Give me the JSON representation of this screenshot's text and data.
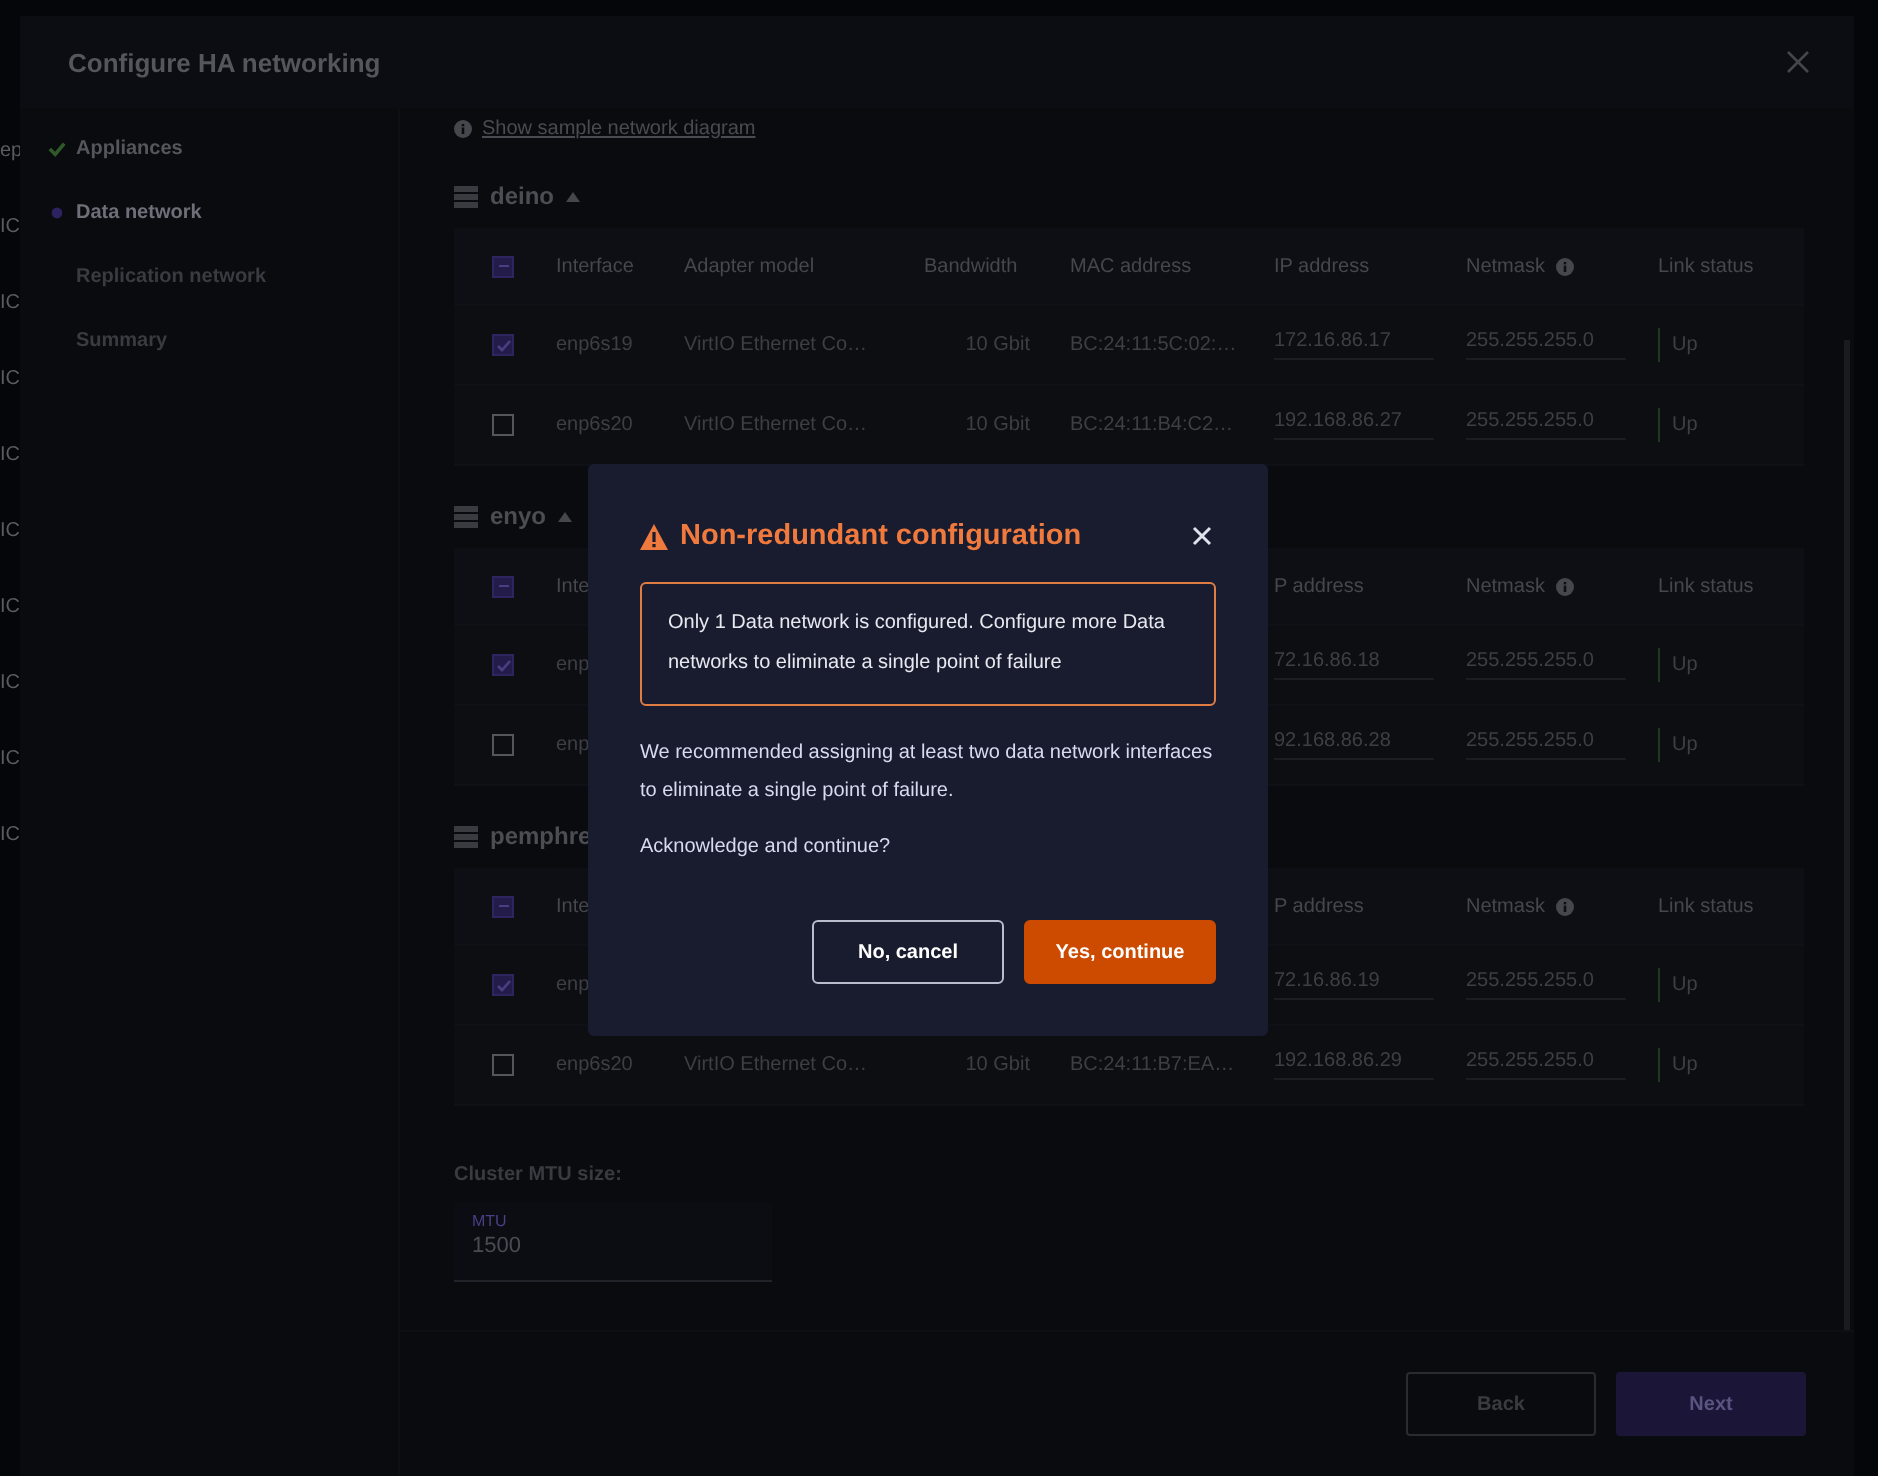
{
  "background_page": {
    "items": [
      "ep",
      "IC",
      "IC",
      "IC",
      "IC",
      "IC",
      "IC",
      "IC",
      "IC",
      "IC"
    ]
  },
  "window": {
    "title": "Configure HA networking"
  },
  "steps": [
    {
      "label": "Appliances",
      "completed": true,
      "selected": false
    },
    {
      "label": "Data network",
      "completed": false,
      "selected": true
    },
    {
      "label": "Replication network",
      "completed": false,
      "selected": false
    },
    {
      "label": "Summary",
      "completed": false,
      "selected": false
    }
  ],
  "diagram_link": "Show sample network diagram",
  "groups": [
    {
      "name": "deino",
      "expanded": true,
      "header": {
        "checked": false,
        "indeterminate": true,
        "columns": [
          {
            "label": "Interface",
            "kind": "text",
            "hint": false
          },
          {
            "label": "Adapter model",
            "kind": "text",
            "hint": false
          },
          {
            "label": "Bandwidth",
            "kind": "number",
            "hint": false
          },
          {
            "label": "MAC address",
            "kind": "text",
            "hint": false
          },
          {
            "label": "IP address",
            "kind": "field",
            "hint": false
          },
          {
            "label": "Netmask",
            "kind": "field",
            "hint": true
          },
          {
            "label": "Link status",
            "kind": "status",
            "hint": false
          }
        ]
      },
      "rows": [
        {
          "selected": true,
          "cells": [
            "enp6s19",
            "VirtIO Ethernet Co…",
            "10 Gbit",
            "BC:24:11:5C:02:…",
            "172.16.86.17",
            "255.255.255.0",
            "Up"
          ]
        },
        {
          "selected": false,
          "cells": [
            "enp6s20",
            "VirtIO Ethernet Co…",
            "10 Gbit",
            "BC:24:11:B4:C2…",
            "192.168.86.27",
            "255.255.255.0",
            "Up"
          ]
        }
      ]
    },
    {
      "name": "enyo",
      "expanded": true,
      "header": {
        "checked": false,
        "indeterminate": true,
        "columns": [
          {
            "label": "Inte",
            "kind": "text"
          },
          null,
          null,
          null,
          {
            "label": "P address",
            "kind": "field",
            "hint": false
          },
          {
            "label": "Netmask",
            "kind": "field",
            "hint": true
          },
          {
            "label": "Link status",
            "kind": "status",
            "hint": false
          }
        ]
      },
      "rows": [
        {
          "selected": true,
          "cells": [
            "enp",
            null,
            null,
            null,
            "72.16.86.18",
            "255.255.255.0",
            "Up"
          ]
        },
        {
          "selected": false,
          "cells": [
            "enp",
            null,
            null,
            null,
            "92.168.86.28",
            "255.255.255.0",
            "Up"
          ]
        }
      ]
    },
    {
      "name": "pemphre",
      "header": {
        "checked": false,
        "indeterminate": true,
        "columns": [
          {
            "label": "Inte",
            "kind": "text"
          },
          null,
          null,
          null,
          {
            "label": "P address",
            "kind": "field",
            "hint": false
          },
          {
            "label": "Netmask",
            "kind": "field",
            "hint": true
          },
          {
            "label": "Link status",
            "kind": "status",
            "hint": false
          }
        ]
      },
      "rows": [
        {
          "selected": true,
          "cells": [
            "enp",
            null,
            null,
            null,
            "72.16.86.19",
            "255.255.255.0",
            "Up"
          ]
        },
        {
          "selected": false,
          "cells": [
            "enp6s20",
            "VirtIO Ethernet Co…",
            "10 Gbit",
            "BC:24:11:B7:EA…",
            "192.168.86.29",
            "255.255.255.0",
            "Up"
          ]
        }
      ]
    }
  ],
  "mtu": {
    "section_label": "Cluster MTU size:",
    "field_label": "MTU",
    "value": "1500"
  },
  "footer": {
    "buttons": [
      {
        "label": "Back",
        "kind": "secondary"
      },
      {
        "label": "Next",
        "kind": "primary"
      }
    ]
  },
  "dialog": {
    "title": "Non-redundant configuration",
    "alert": "Only 1 Data network is configured. Configure more Data networks to eliminate a single point of failure",
    "body": "We recommended assigning at least two data network interfaces to eliminate a single point of failure.",
    "question": "Acknowledge and continue?",
    "buttons": [
      {
        "label": "No, cancel",
        "kind": "secondary"
      },
      {
        "label": "Yes, continue",
        "kind": "primary"
      }
    ]
  }
}
